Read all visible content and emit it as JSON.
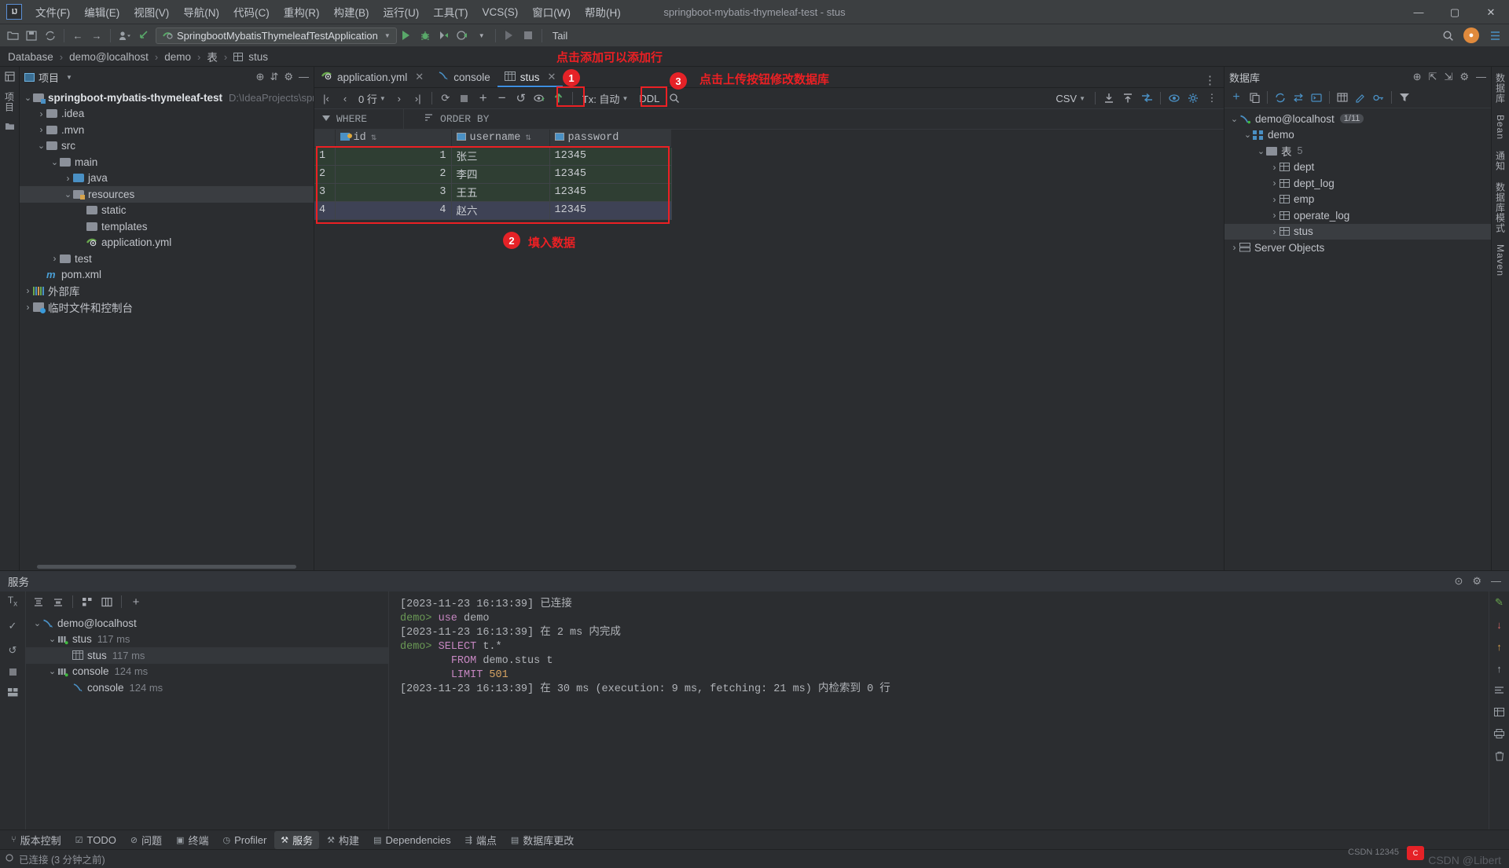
{
  "window": {
    "title": "springboot-mybatis-thymeleaf-test - stus",
    "minimize": "—",
    "maximize": "▢",
    "close": "✕"
  },
  "menu": [
    {
      "label": "文件(F)"
    },
    {
      "label": "编辑(E)"
    },
    {
      "label": "视图(V)"
    },
    {
      "label": "导航(N)"
    },
    {
      "label": "代码(C)"
    },
    {
      "label": "重构(R)"
    },
    {
      "label": "构建(B)"
    },
    {
      "label": "运行(U)"
    },
    {
      "label": "工具(T)"
    },
    {
      "label": "VCS(S)"
    },
    {
      "label": "窗口(W)"
    },
    {
      "label": "帮助(H)"
    }
  ],
  "toolbar": {
    "run_config": "SpringbootMybatisThymeleafTestApplication",
    "tail_label": "Tail",
    "icons": [
      "open-folder-icon",
      "save-icon",
      "sync-icon",
      "back-arrow-icon",
      "forward-arrow-icon",
      "profile-icon",
      "vcs-update-icon"
    ],
    "right_icons": [
      "search-icon",
      "account-avatar",
      "ide-settings-icon"
    ]
  },
  "breadcrumb": {
    "items": [
      "Database",
      "demo@localhost",
      "demo",
      "表",
      "stus"
    ],
    "separator": "›"
  },
  "project_panel": {
    "title": "项目",
    "vertical_tab": "项目",
    "tree": [
      {
        "label": "springboot-mybatis-thymeleaf-test",
        "path": "D:\\IdeaProjects\\springboot-mybatis-",
        "indent": 0,
        "arrow": "v",
        "icon": "module-folder-icon",
        "bold": true
      },
      {
        "label": ".idea",
        "indent": 1,
        "arrow": ">",
        "icon": "folder-icon"
      },
      {
        "label": ".mvn",
        "indent": 1,
        "arrow": ">",
        "icon": "folder-icon"
      },
      {
        "label": "src",
        "indent": 1,
        "arrow": "v",
        "icon": "folder-icon"
      },
      {
        "label": "main",
        "indent": 2,
        "arrow": "v",
        "icon": "folder-icon"
      },
      {
        "label": "java",
        "indent": 3,
        "arrow": ">",
        "icon": "source-folder-icon"
      },
      {
        "label": "resources",
        "indent": 3,
        "arrow": "v",
        "icon": "resources-folder-icon",
        "selected": true
      },
      {
        "label": "static",
        "indent": 4,
        "arrow": "",
        "icon": "folder-icon"
      },
      {
        "label": "templates",
        "indent": 4,
        "arrow": "",
        "icon": "folder-icon"
      },
      {
        "label": "application.yml",
        "indent": 4,
        "arrow": "",
        "icon": "spring-yml-icon"
      },
      {
        "label": "test",
        "indent": 2,
        "arrow": ">",
        "icon": "folder-icon"
      },
      {
        "label": "pom.xml",
        "indent": 1,
        "arrow": "",
        "icon": "maven-icon"
      },
      {
        "label": "外部库",
        "indent": 0,
        "arrow": ">",
        "icon": "libraries-icon"
      },
      {
        "label": "临时文件和控制台",
        "indent": 0,
        "arrow": ">",
        "icon": "scratches-icon"
      }
    ]
  },
  "editor": {
    "tabs": [
      {
        "label": "application.yml",
        "icon": "spring-yml-icon",
        "active": false,
        "close": "✕"
      },
      {
        "label": "console",
        "icon": "console-icon",
        "active": false,
        "close": ""
      },
      {
        "label": "stus",
        "icon": "table-icon",
        "active": true,
        "close": "✕"
      }
    ],
    "grid_toolbar": {
      "first_page": "|‹",
      "prev_page": "‹",
      "rows_label": "0 行",
      "next_page": "›",
      "last_page": "›|",
      "refresh": "⟳",
      "stop": "■",
      "add_row": "+",
      "remove_row": "−",
      "revert": "↺",
      "preview": "👁",
      "submit": "⬆",
      "tx_label": "Tx: 自动",
      "ddl_label": "DDL",
      "search": "🔍",
      "export_format": "CSV",
      "download": "⤓",
      "upload": "⤒",
      "compare": "⇄",
      "view_options": "👁",
      "settings": "⚙",
      "more": "⋮"
    },
    "filter_bar": {
      "where_label": "WHERE",
      "orderby_label": "ORDER BY"
    },
    "table": {
      "columns": [
        "",
        "id",
        "username",
        "password"
      ],
      "rows": [
        {
          "n": "1",
          "id": "1",
          "username": "张三",
          "password": "12345",
          "selected": false
        },
        {
          "n": "2",
          "id": "2",
          "username": "李四",
          "password": "12345",
          "selected": false
        },
        {
          "n": "3",
          "id": "3",
          "username": "王五",
          "password": "12345",
          "selected": false
        },
        {
          "n": "4",
          "id": "4",
          "username": "赵六",
          "password": "12345",
          "selected": true
        }
      ]
    }
  },
  "annotations": [
    {
      "id": "1",
      "text": "点击添加可以添加行"
    },
    {
      "id": "2",
      "text": "填入数据"
    },
    {
      "id": "3",
      "text": "点击上传按钮修改数据库"
    }
  ],
  "db_panel": {
    "title": "数据库",
    "toolbar_icons": [
      "add-icon",
      "duplicate-icon",
      "refresh-icon",
      "sync-icon",
      "jump-icon",
      "table-icon",
      "edit-icon",
      "key-icon",
      "filter-icon"
    ],
    "tree": [
      {
        "label": "demo@localhost",
        "badge": "1/11",
        "indent": 0,
        "arrow": "v",
        "icon": "mysql-connection-icon"
      },
      {
        "label": "demo",
        "indent": 1,
        "arrow": "v",
        "icon": "schema-icon"
      },
      {
        "label": "表",
        "badge_plain": "5",
        "indent": 2,
        "arrow": "v",
        "icon": "folder-icon"
      },
      {
        "label": "dept",
        "indent": 3,
        "arrow": ">",
        "icon": "table-icon"
      },
      {
        "label": "dept_log",
        "indent": 3,
        "arrow": ">",
        "icon": "table-icon"
      },
      {
        "label": "emp",
        "indent": 3,
        "arrow": ">",
        "icon": "table-icon"
      },
      {
        "label": "operate_log",
        "indent": 3,
        "arrow": ">",
        "icon": "table-icon"
      },
      {
        "label": "stus",
        "indent": 3,
        "arrow": ">",
        "icon": "table-icon",
        "selected": true
      },
      {
        "label": "Server Objects",
        "indent": 0,
        "arrow": ">",
        "icon": "server-objects-icon"
      }
    ],
    "vertical_tabs": [
      "数据库",
      "Bean",
      "通知",
      "数据库模式",
      "Maven"
    ]
  },
  "services": {
    "title": "服务",
    "toolbar": [
      "Tx",
      "expand-all-icon",
      "collapse-all-icon",
      "layout-icon",
      "split-icon",
      "add-icon"
    ],
    "gutter_icons": [
      "commit-check-icon",
      "rollback-icon",
      "stop-icon",
      "layout-icon"
    ],
    "tree": [
      {
        "label": "demo@localhost",
        "time": "",
        "indent": 0,
        "arrow": "v",
        "icon": "mysql-connection-icon"
      },
      {
        "label": "stus",
        "time": "117 ms",
        "indent": 1,
        "arrow": "v",
        "icon": "session-icon"
      },
      {
        "label": "stus",
        "time": "117 ms",
        "indent": 2,
        "arrow": "",
        "icon": "table-icon",
        "selected": true
      },
      {
        "label": "console",
        "time": "124 ms",
        "indent": 1,
        "arrow": "v",
        "icon": "session-icon"
      },
      {
        "label": "console",
        "time": "124 ms",
        "indent": 2,
        "arrow": "",
        "icon": "console-icon"
      }
    ],
    "console_lines": [
      [
        {
          "t": "[2023-11-23 16:13:39] 已连接",
          "c": "grey"
        }
      ],
      [
        {
          "t": "demo> ",
          "c": "green"
        },
        {
          "t": "use",
          "c": "purple"
        },
        {
          "t": " demo",
          "c": "grey"
        }
      ],
      [
        {
          "t": "[2023-11-23 16:13:39] 在 2 ms 内完成",
          "c": "grey"
        }
      ],
      [
        {
          "t": "demo> ",
          "c": "green"
        },
        {
          "t": "SELECT",
          "c": "purple"
        },
        {
          "t": " t.*",
          "c": "grey"
        }
      ],
      [
        {
          "t": "        ",
          "c": "grey"
        },
        {
          "t": "FROM",
          "c": "purple"
        },
        {
          "t": " demo.stus t",
          "c": "grey"
        }
      ],
      [
        {
          "t": "        ",
          "c": "grey"
        },
        {
          "t": "LIMIT",
          "c": "purple"
        },
        {
          "t": " 501",
          "c": "orange"
        }
      ],
      [
        {
          "t": "[2023-11-23 16:13:39] 在 30 ms (execution: 9 ms, fetching: 21 ms) 内检索到 0 行",
          "c": "grey"
        }
      ]
    ],
    "right_icons": [
      "edit-icon",
      "down-arrow-icon",
      "up-arrow-icon",
      "up-line-icon",
      "wrap-icon",
      "table-view-icon",
      "print-icon",
      "delete-icon"
    ]
  },
  "toolwindow_bar": [
    {
      "label": "版本控制",
      "icon": "vcs-icon",
      "active": false
    },
    {
      "label": "TODO",
      "icon": "todo-icon",
      "active": false
    },
    {
      "label": "问题",
      "icon": "problems-icon",
      "active": false
    },
    {
      "label": "终端",
      "icon": "terminal-icon",
      "active": false
    },
    {
      "label": "Profiler",
      "icon": "profiler-icon",
      "active": false
    },
    {
      "label": "服务",
      "icon": "services-icon",
      "active": true
    },
    {
      "label": "构建",
      "icon": "build-icon",
      "active": false
    },
    {
      "label": "Dependencies",
      "icon": "dependencies-icon",
      "active": false
    },
    {
      "label": "端点",
      "icon": "endpoints-icon",
      "active": false
    },
    {
      "label": "数据库更改",
      "icon": "db-changes-icon",
      "active": false
    }
  ],
  "statusbar": {
    "text": "已连接 (3 分钟之前)",
    "watermark": "CSDN @Libert",
    "watermark2": "CSDN 12345"
  }
}
